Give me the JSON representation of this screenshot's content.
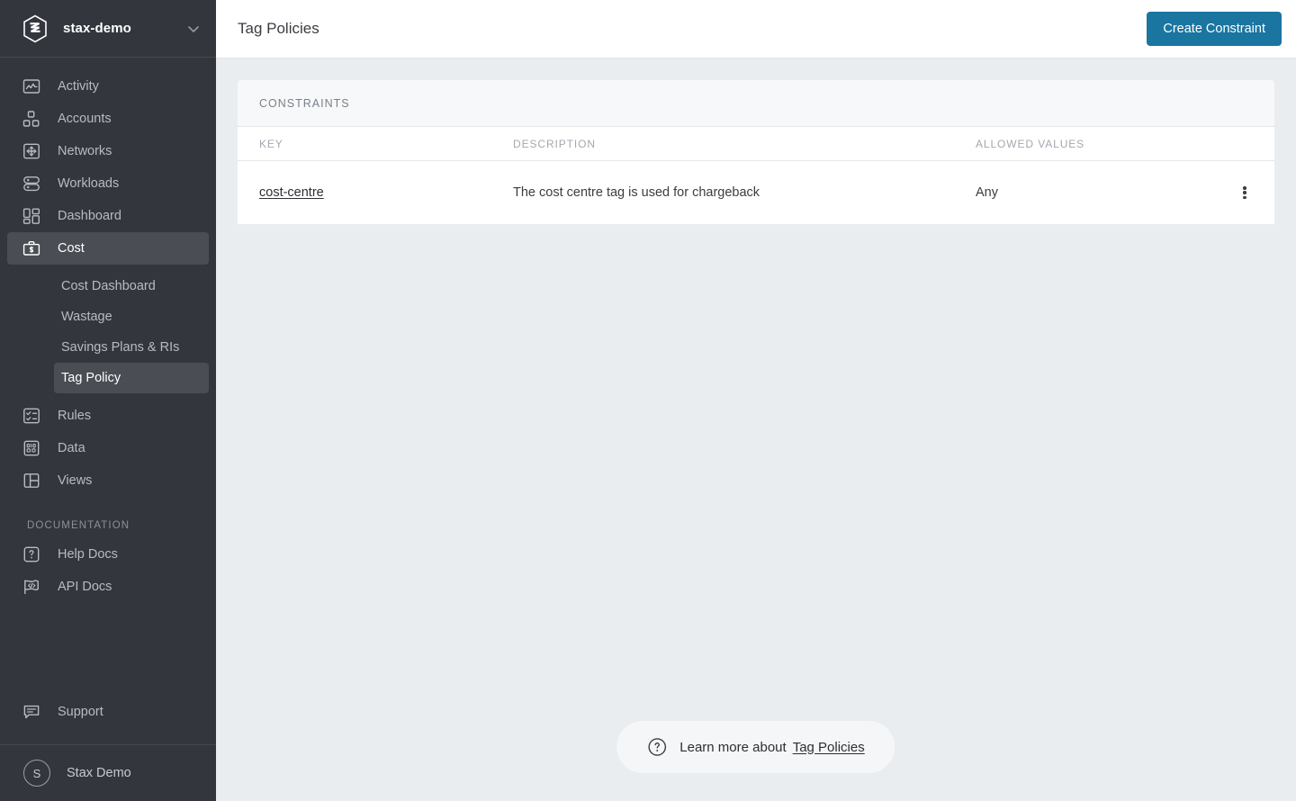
{
  "sidebar": {
    "org": {
      "name": "stax-demo",
      "logo_icon": "stax-hexagon-logo",
      "chevron_icon": "chevron-down-icon"
    },
    "items": [
      {
        "label": "Activity",
        "icon": "activity-chart-icon",
        "active": false
      },
      {
        "label": "Accounts",
        "icon": "accounts-nodes-icon",
        "active": false
      },
      {
        "label": "Networks",
        "icon": "networks-move-icon",
        "active": false
      },
      {
        "label": "Workloads",
        "icon": "workloads-stack-icon",
        "active": false
      },
      {
        "label": "Dashboard",
        "icon": "dashboard-grid-icon",
        "active": false
      },
      {
        "label": "Cost",
        "icon": "cost-briefcase-icon",
        "active": true
      }
    ],
    "cost_subitems": [
      {
        "label": "Cost Dashboard",
        "active": false
      },
      {
        "label": "Wastage",
        "active": false
      },
      {
        "label": "Savings Plans & RIs",
        "active": false
      },
      {
        "label": "Tag Policy",
        "active": true
      }
    ],
    "items_after": [
      {
        "label": "Rules",
        "icon": "rules-checklist-icon",
        "active": false
      },
      {
        "label": "Data",
        "icon": "data-binary-icon",
        "active": false
      },
      {
        "label": "Views",
        "icon": "views-layout-icon",
        "active": false
      }
    ],
    "documentation_label": "Documentation",
    "doc_items": [
      {
        "label": "Help Docs",
        "icon": "help-question-icon",
        "active": false
      },
      {
        "label": "API Docs",
        "icon": "api-flag-code-icon",
        "active": false
      }
    ],
    "support": {
      "label": "Support",
      "icon": "support-chat-icon"
    },
    "user": {
      "initial": "S",
      "name": "Stax Demo"
    }
  },
  "header": {
    "title": "Tag Policies",
    "create_button": "Create Constraint"
  },
  "card": {
    "title": "CONSTRAINTS",
    "columns": [
      "KEY",
      "DESCRIPTION",
      "ALLOWED VALUES",
      ""
    ],
    "rows": [
      {
        "key": "cost-centre",
        "description": "The cost centre tag is used for chargeback",
        "allowed_values": "Any",
        "actions_icon": "kebab-menu-icon"
      }
    ]
  },
  "learn_more": {
    "icon": "help-circle-icon",
    "text": "Learn more about",
    "link": "Tag Policies"
  },
  "colors": {
    "sidebar_bg": "#33363d",
    "sidebar_active": "#4a4d54",
    "accent": "#1a75a0",
    "content_bg": "#eaedf0",
    "card_header_bg": "#f6f8f9"
  }
}
